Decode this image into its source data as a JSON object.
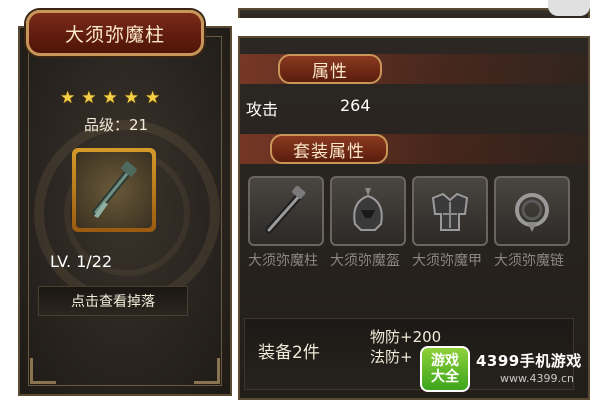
{
  "item": {
    "name": "大须弥魔柱",
    "stars": 5,
    "grade_text": "品级：21",
    "level_text": "LV. 1/22",
    "view_drop_label": "点击查看掉落",
    "icon": "staff-icon"
  },
  "attributes": {
    "header": "属性",
    "list": [
      {
        "name": "攻击",
        "value": "264"
      }
    ]
  },
  "set": {
    "header": "套装属性",
    "pieces": [
      {
        "name": "大须弥魔柱",
        "icon": "staff-icon"
      },
      {
        "name": "大须弥魔盔",
        "icon": "helmet-icon"
      },
      {
        "name": "大须弥魔甲",
        "icon": "armor-icon"
      },
      {
        "name": "大须弥魔链",
        "icon": "necklace-icon"
      }
    ],
    "bonus": {
      "label": "装备2件",
      "lines": [
        "物防+200",
        "法防+"
      ]
    }
  },
  "watermark": {
    "badge_top": "游戏",
    "badge_bottom": "大全",
    "title": "4399手机游戏",
    "url": "www.4399.cn"
  },
  "colors": {
    "panel_bg": "#2a2520",
    "banner_red": "#6b2010",
    "gold_border": "#c9965a",
    "star": "#f5cf45",
    "item_frame": "#d79b2a",
    "disabled_text": "#8c8680"
  }
}
